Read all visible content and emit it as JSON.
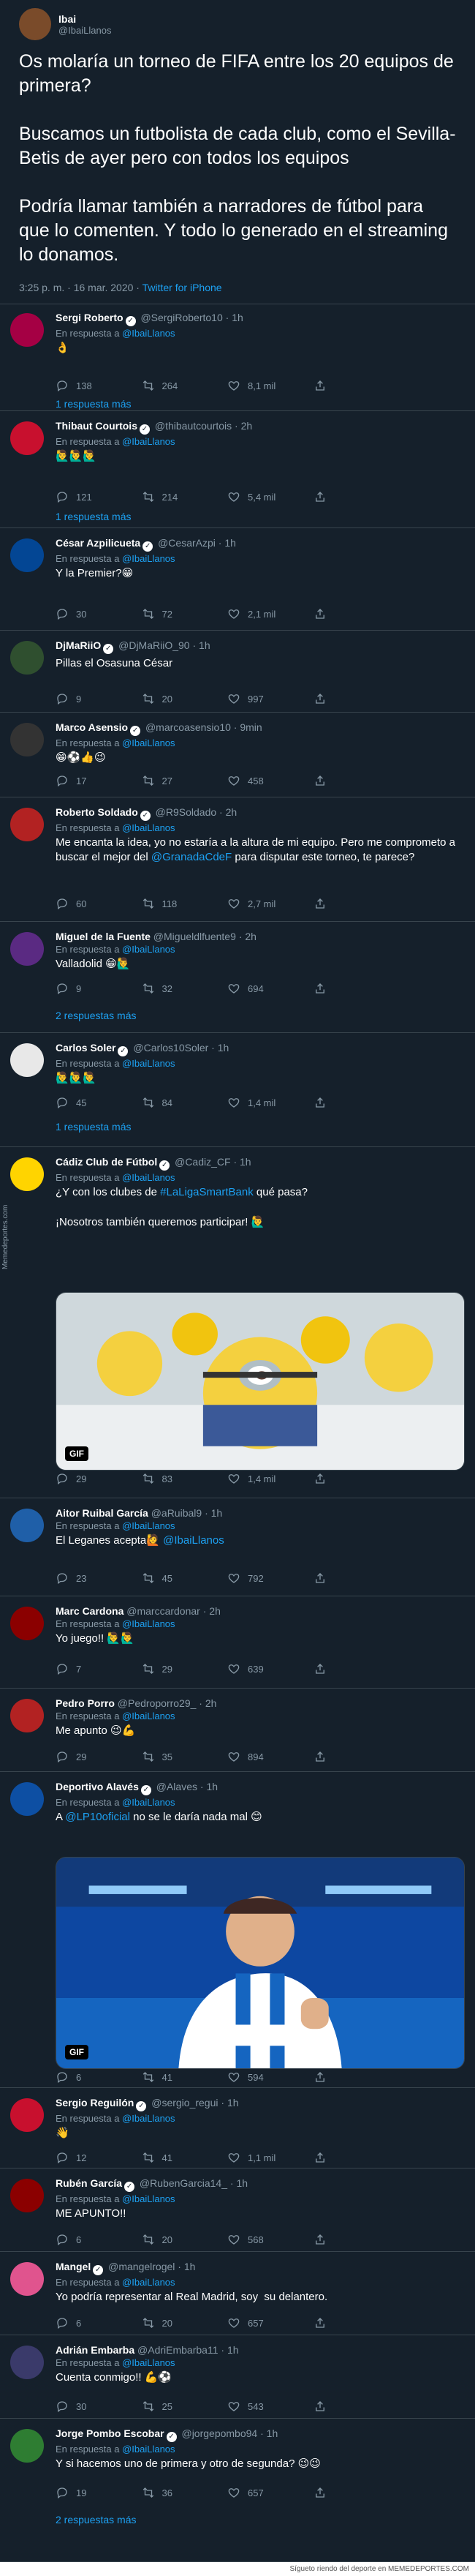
{
  "main_tweet": {
    "name": "Ibai",
    "handle": "@IbaiLlanos",
    "text": "Os molaría un torneo de FIFA entre los 20 equipos de primera?\n\nBuscamos un futbolista de cada club, como el Sevilla-Betis de ayer pero con todos los equipos\n\nPodría llamar también a narradores de fútbol para que lo comenten. Y todo lo generado en el streaming lo donamos.",
    "time": "3:25 p. m. · 16 mar. 2020 · ",
    "source": "Twitter for iPhone"
  },
  "in_reply_prefix": "En respuesta a ",
  "replies": [
    {
      "name": "Sergi Roberto",
      "handle": "@SergiRoberto10",
      "time": "1h",
      "verified": true,
      "mention": "@IbaiLlanos",
      "text": "👌",
      "counts": [
        "138",
        "264",
        "8,1 mil"
      ],
      "more": "1 respuesta más",
      "avatar_color": "#a50044"
    },
    {
      "name": "Thibaut Courtois",
      "handle": "@thibautcourtois",
      "time": "2h",
      "verified": true,
      "mention": "@IbaiLlanos",
      "text": "🙋‍♂️🙋‍♂️🙋‍♂️",
      "counts": [
        "121",
        "214",
        "5,4 mil"
      ],
      "more": "1 respuesta más",
      "avatar_color": "#c8102e"
    },
    {
      "name": "César Azpilicueta",
      "handle": "@CesarAzpi",
      "time": "1h",
      "verified": true,
      "mention": "@IbaiLlanos",
      "text": "Y la Premier?😁",
      "counts": [
        "30",
        "72",
        "2,1 mil"
      ],
      "more": "",
      "avatar_color": "#034694"
    },
    {
      "name": "DjMaRiiO",
      "handle": "@DjMaRiiO_90",
      "time": "1h",
      "verified": true,
      "mention": "",
      "text": "Pillas el Osasuna César",
      "counts": [
        "9",
        "20",
        "997"
      ],
      "more": "",
      "avatar_color": "#2f4f2f"
    },
    {
      "name": "Marco Asensio",
      "handle": "@marcoasensio10",
      "time": "9min",
      "verified": true,
      "mention": "@IbaiLlanos",
      "text": "😁⚽👍😉",
      "counts": [
        "17",
        "27",
        "458"
      ],
      "more": "",
      "avatar_color": "#333333"
    },
    {
      "name": "Roberto Soldado",
      "handle": "@R9Soldado",
      "time": "2h",
      "verified": true,
      "mention": "@IbaiLlanos",
      "text": "Me encanta la idea, yo no estaría a la altura de mi equipo. Pero me comprometo a buscar el mejor del @GranadaCdeF para disputar este torneo, te parece?",
      "counts": [
        "60",
        "118",
        "2,7 mil"
      ],
      "more": "",
      "avatar_color": "#b22222"
    },
    {
      "name": "Miguel de la Fuente",
      "handle": "@Migueldlfuente9",
      "time": "2h",
      "verified": false,
      "mention": "@IbaiLlanos",
      "text": "Valladolid 😁🙋‍♂️",
      "counts": [
        "9",
        "32",
        "694"
      ],
      "more": "2 respuestas más",
      "avatar_color": "#5a2a82"
    },
    {
      "name": "Carlos Soler",
      "handle": "@Carlos10Soler",
      "time": "1h",
      "verified": true,
      "mention": "@IbaiLlanos",
      "text": "🙋‍♂️🙋‍♂️🙋‍♂️",
      "counts": [
        "45",
        "84",
        "1,4 mil"
      ],
      "more": "1 respuesta más",
      "avatar_color": "#e8e8e8"
    },
    {
      "name": "Cádiz Club de Fútbol",
      "handle": "@Cadiz_CF",
      "time": "1h",
      "verified": true,
      "mention": "@IbaiLlanos",
      "text": "¿Y con los clubes de #LaLigaSmartBank qué pasa?\n\n¡Nosotros también queremos participar! 🙋‍♂️",
      "media_badge": "GIF",
      "counts": [
        "29",
        "83",
        "1,4 mil"
      ],
      "more": "",
      "avatar_color": "#ffd400"
    },
    {
      "name": "Aitor Ruibal García",
      "handle": "@aRuibal9",
      "time": "1h",
      "verified": false,
      "mention": "@IbaiLlanos",
      "text": "El Leganes acepta🙋 @IbaiLlanos",
      "counts": [
        "23",
        "45",
        "792"
      ],
      "more": "",
      "avatar_color": "#1f5fa8"
    },
    {
      "name": "Marc Cardona",
      "handle": "@marccardonar",
      "time": "2h",
      "verified": false,
      "mention": "@IbaiLlanos",
      "text": "Yo juego!! 🙋‍♂️🙋‍♂️",
      "counts": [
        "7",
        "29",
        "639"
      ],
      "more": "",
      "avatar_color": "#8b0000"
    },
    {
      "name": "Pedro Porro",
      "handle": "@Pedroporro29_",
      "time": "2h",
      "verified": false,
      "mention": "@IbaiLlanos",
      "text": "Me apunto 😉💪",
      "counts": [
        "29",
        "35",
        "894"
      ],
      "more": "",
      "avatar_color": "#b22222"
    },
    {
      "name": "Deportivo Alavés",
      "handle": "@Alaves",
      "time": "1h",
      "verified": true,
      "mention": "@IbaiLlanos",
      "text": "A @LP10oficial no se le daría nada mal 😊",
      "media_badge": "GIF",
      "counts": [
        "6",
        "41",
        "594"
      ],
      "more": "",
      "avatar_color": "#0d4fa3"
    },
    {
      "name": "Sergio Reguilón",
      "handle": "@sergio_regui",
      "time": "1h",
      "verified": true,
      "mention": "@IbaiLlanos",
      "text": "👋",
      "counts": [
        "12",
        "41",
        "1,1 mil"
      ],
      "more": "",
      "avatar_color": "#c8102e"
    },
    {
      "name": "Rubén García",
      "handle": "@RubenGarcia14_",
      "time": "1h",
      "verified": true,
      "mention": "@IbaiLlanos",
      "text": "ME APUNTO!!",
      "counts": [
        "6",
        "20",
        "568"
      ],
      "more": "",
      "avatar_color": "#8b0000"
    },
    {
      "name": "Mangel",
      "handle": "@mangelrogel",
      "time": "1h",
      "verified": true,
      "mention": "@IbaiLlanos",
      "text": "Yo podría representar al Real Madrid, soy  su delantero.",
      "counts": [
        "6",
        "20",
        "657"
      ],
      "more": "",
      "avatar_color": "#e0548e"
    },
    {
      "name": "Adrián Embarba",
      "handle": "@AdriEmbarba11",
      "time": "1h",
      "verified": false,
      "mention": "@IbaiLlanos",
      "text": "Cuenta conmigo!! 💪⚽",
      "counts": [
        "30",
        "25",
        "543"
      ],
      "more": "",
      "avatar_color": "#3a3a6a"
    },
    {
      "name": "Jorge Pombo Escobar",
      "handle": "@jorgepombo94",
      "time": "1h",
      "verified": true,
      "mention": "@IbaiLlanos",
      "text": "Y si hacemos uno de primera y otro de segunda? 😉😉",
      "counts": [
        "19",
        "36",
        "657"
      ],
      "more": "2 respuestas más",
      "avatar_color": "#2e7d32"
    }
  ],
  "watermark": "Memedeportes.com",
  "footer": "Sígueto riendo del deporte en MEMEDEPORTES.COM",
  "colors": {
    "background": "#15202b",
    "accent": "#1da1f2",
    "muted": "#8899a6",
    "divider": "#38444d"
  }
}
